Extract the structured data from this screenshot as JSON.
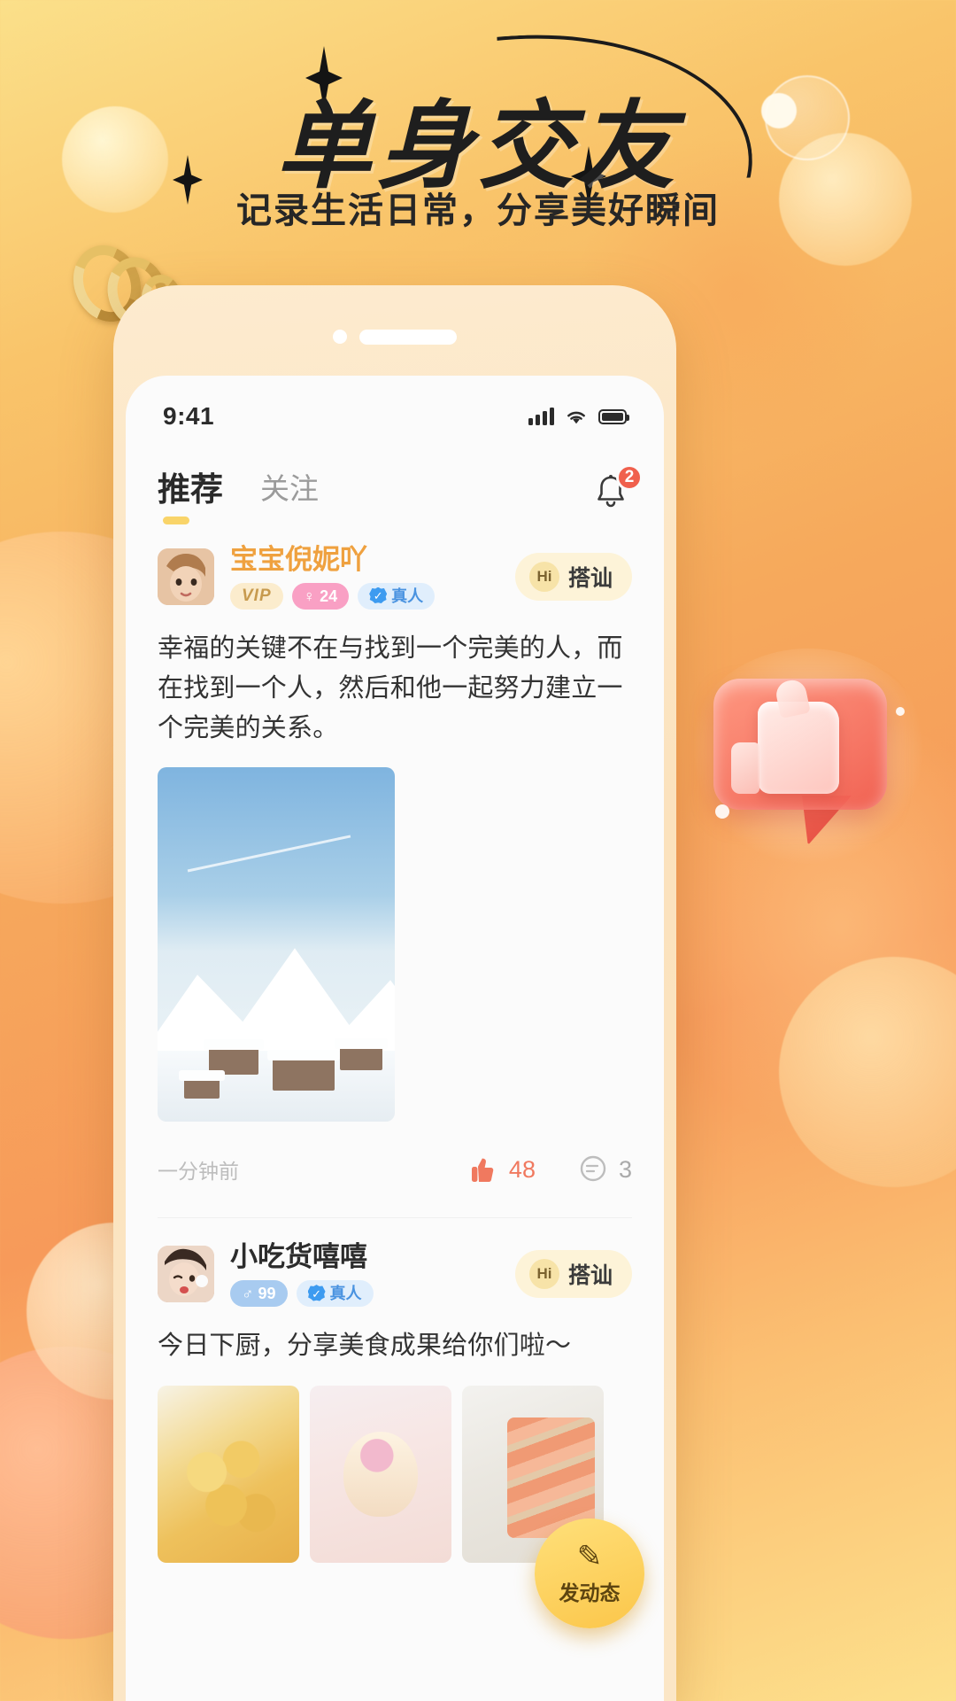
{
  "poster": {
    "headline": "单身交友",
    "subheadline": "记录生活日常，分享美好瞬间"
  },
  "phone": {
    "statusbar": {
      "time": "9:41",
      "signal_icon": "cellular-signal-icon",
      "wifi_icon": "wifi-icon",
      "battery_icon": "battery-icon"
    },
    "tabs": [
      {
        "label": "推荐",
        "active": true
      },
      {
        "label": "关注",
        "active": false
      }
    ],
    "notification": {
      "icon": "bell-icon",
      "badge_count": "2"
    },
    "posts": [
      {
        "avatar_name": "avatar",
        "username": "宝宝倪妮吖",
        "badges": [
          {
            "type": "vip",
            "label": "VIP"
          },
          {
            "type": "gender_age",
            "glyph": "♀",
            "label": "24"
          },
          {
            "type": "verified",
            "label": "真人"
          }
        ],
        "greet_button": {
          "hi": "Hi",
          "label": "搭讪"
        },
        "text": "幸福的关键不在与找到一个完美的人，而在找到一个人，然后和他一起努力建立一个完美的关系。",
        "timestamp": "一分钟前",
        "like_count": "48",
        "comment_count": "3",
        "like_icon": "thumbs-up-icon",
        "comment_icon": "comment-bubble-icon"
      },
      {
        "avatar_name": "avatar",
        "username": "小吃货嘻嘻",
        "badges": [
          {
            "type": "gender_age",
            "glyph": "♂",
            "label": "99"
          },
          {
            "type": "verified",
            "label": "真人"
          }
        ],
        "greet_button": {
          "hi": "Hi",
          "label": "搭讪"
        },
        "text": "今日下厨，分享美食成果给你们啦～"
      }
    ],
    "fab": {
      "icon": "pencil-icon",
      "label": "发动态"
    }
  },
  "colors": {
    "accent_orange": "#efa13f",
    "like_red": "#f0795f",
    "badge_red": "#f0604d",
    "tab_underline": "#f9d469",
    "fab_yellow": "#fbc64a"
  }
}
